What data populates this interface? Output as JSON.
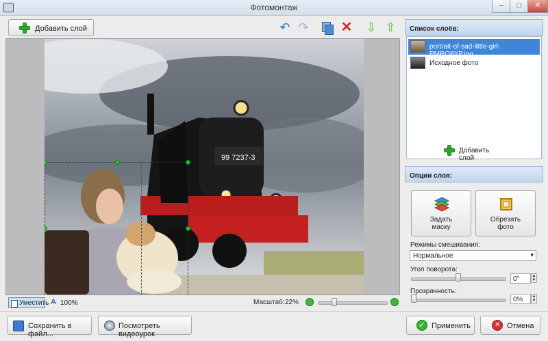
{
  "window": {
    "title": "Фотомонтаж",
    "minimize": "–",
    "maximize": "□",
    "close": "✕"
  },
  "toolbar": {
    "add_layer": "Добавить слой"
  },
  "layers_panel": {
    "title": "Список слоёв:",
    "items": [
      {
        "label": "portrait-of-sad-little-girl-PMRQ8YP.jpg",
        "selected": true
      },
      {
        "label": "Исходное фото",
        "selected": false
      }
    ],
    "add_layer": "Добавить слой"
  },
  "options_panel": {
    "title": "Опции слоя:",
    "mask_button": [
      "Задать",
      "маску"
    ],
    "crop_button": [
      "Обрезать",
      "фото"
    ],
    "blend_label": "Режимы смешивания:",
    "blend_value": "Нормальное",
    "rotation_label": "Угол поворота:",
    "rotation_value": "0°",
    "rotation_level": 0.5,
    "opacity_label": "Прозрачность:",
    "opacity_value": "0%",
    "opacity_level": 0
  },
  "statusbar": {
    "fit": "Уместить",
    "actual": "100%",
    "zoom_label": "Масштаб:",
    "zoom_value": "22%",
    "zoom_level": 0.22
  },
  "bottom": {
    "save": "Сохранить в файл...",
    "video": "Посмотреть видеоурок",
    "apply": "Применить",
    "cancel": "Отмена"
  },
  "photo": {
    "plate": "99 7237-3"
  },
  "colors": {
    "accent": "#3d86d8",
    "green": "#2eab2e",
    "red": "#d42a2a",
    "blue_arrow": "#2d78c8"
  }
}
